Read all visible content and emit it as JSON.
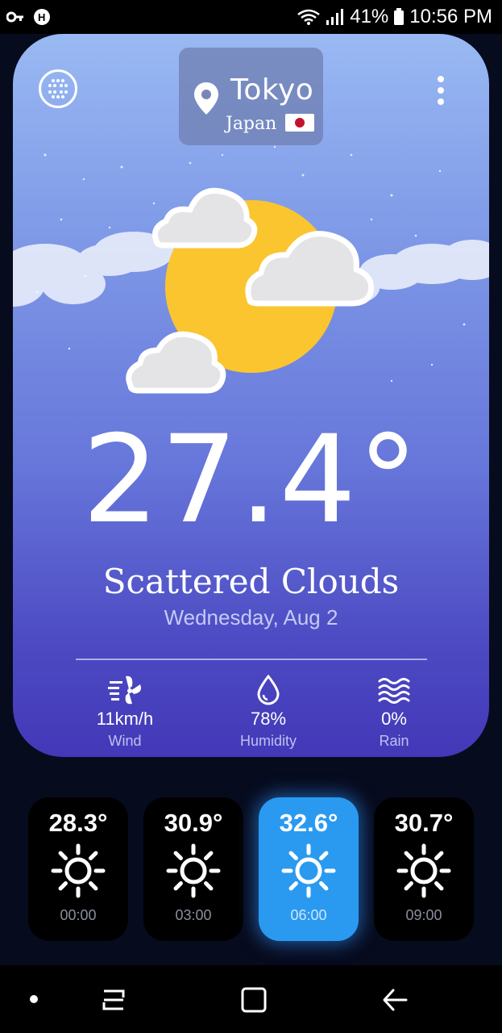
{
  "status_bar": {
    "battery_percent": "41%",
    "time": "10:56 PM"
  },
  "location": {
    "city": "Tokyo",
    "country": "Japan"
  },
  "current": {
    "temperature": "27.4°",
    "condition": "Scattered Clouds",
    "date": "Wednesday, Aug 2"
  },
  "stats": [
    {
      "value": "11km/h",
      "label": "Wind",
      "icon": "wind-icon"
    },
    {
      "value": "78%",
      "label": "Humidity",
      "icon": "droplet-icon"
    },
    {
      "value": "0%",
      "label": "Rain",
      "icon": "waves-icon"
    }
  ],
  "hourly": [
    {
      "temp": "28.3°",
      "time": "00:00",
      "icon": "sun-icon",
      "selected": false
    },
    {
      "temp": "30.9°",
      "time": "03:00",
      "icon": "sun-icon",
      "selected": false
    },
    {
      "temp": "32.6°",
      "time": "06:00",
      "icon": "sun-icon",
      "selected": true
    },
    {
      "temp": "30.7°",
      "time": "09:00",
      "icon": "sun-icon",
      "selected": false
    }
  ],
  "colors": {
    "accent": "#2a9af0",
    "background": "#070b1e",
    "sun": "#fbc530",
    "flag_red": "#c4122e"
  }
}
